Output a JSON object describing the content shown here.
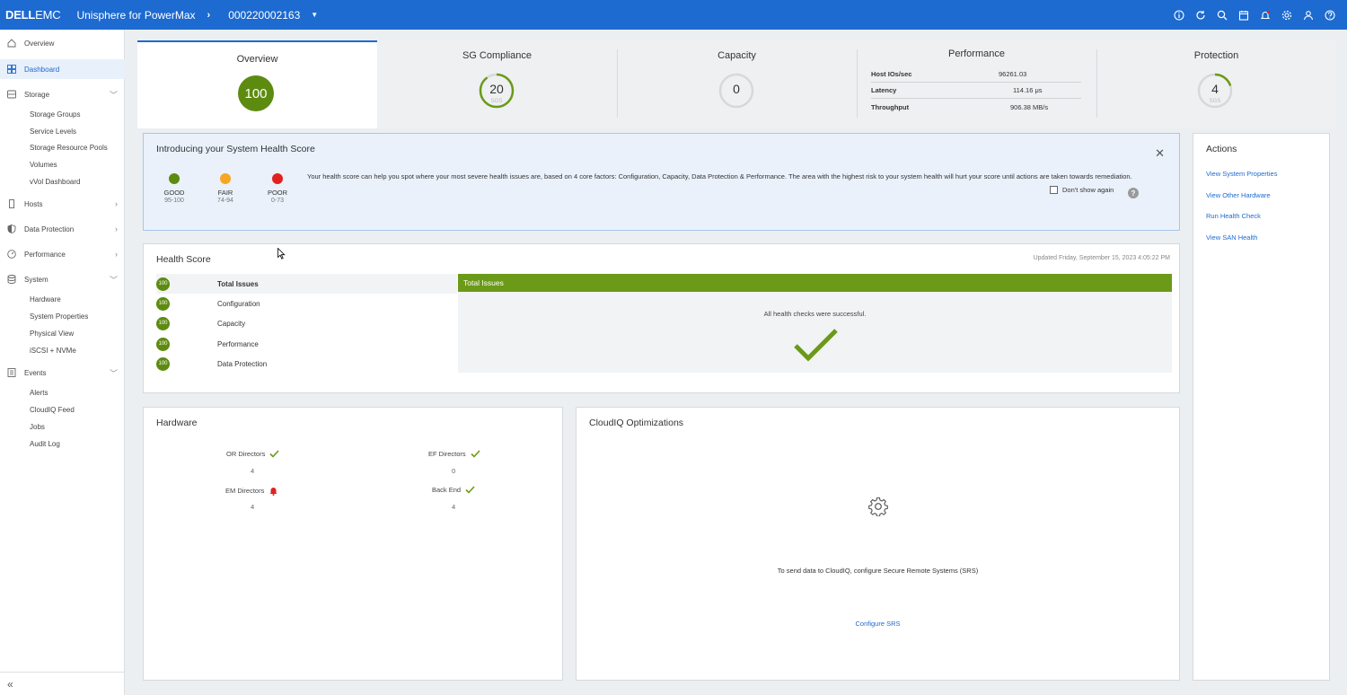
{
  "header": {
    "brand_bold": "DELL",
    "brand_light": "EMC",
    "app_title": "Unisphere for PowerMax",
    "system_id": "000220002163",
    "icons": [
      "info-icon",
      "refresh-icon",
      "search-icon",
      "calendar-icon",
      "bell-icon",
      "gear-icon",
      "user-icon",
      "help-icon"
    ]
  },
  "sidebar": {
    "items": [
      {
        "label": "Overview",
        "icon": "home-icon"
      },
      {
        "label": "Dashboard",
        "icon": "dashboard-icon"
      },
      {
        "label": "Storage",
        "icon": "storage-icon"
      },
      {
        "label": "Hosts",
        "icon": "host-icon"
      },
      {
        "label": "Data Protection",
        "icon": "shield-icon"
      },
      {
        "label": "Performance",
        "icon": "gauge-icon"
      },
      {
        "label": "System",
        "icon": "database-icon"
      },
      {
        "label": "Events",
        "icon": "list-icon"
      }
    ],
    "storage_sub": [
      "Storage Groups",
      "Service Levels",
      "Storage Resource Pools",
      "Volumes",
      "vVol Dashboard"
    ],
    "system_sub": [
      "Hardware",
      "System Properties",
      "Physical View",
      "iSCSI + NVMe"
    ],
    "events_sub": [
      "Alerts",
      "CloudIQ Feed",
      "Jobs",
      "Audit Log"
    ]
  },
  "tiles": {
    "overview": {
      "title": "Overview",
      "score": "100"
    },
    "sg": {
      "title": "SG Compliance",
      "value": "20",
      "unit": "SGS",
      "progress_fraction": 0.9
    },
    "capacity": {
      "title": "Capacity",
      "value": "0"
    },
    "performance": {
      "title": "Performance",
      "rows": [
        {
          "label": "Host IOs/sec",
          "value": "96261.03"
        },
        {
          "label": "Latency",
          "value": "114.16 μs"
        },
        {
          "label": "Throughput",
          "value": "906.38 MB/s"
        }
      ]
    },
    "protection": {
      "title": "Protection",
      "value": "4",
      "unit": "SGS",
      "progress_fraction": 0.2
    }
  },
  "intro": {
    "title": "Introducing your System Health Score",
    "legend": [
      {
        "label": "GOOD",
        "range": "95-100",
        "color": "#5d8b10"
      },
      {
        "label": "FAIR",
        "range": "74-94",
        "color": "#f6a623"
      },
      {
        "label": "POOR",
        "range": "0-73",
        "color": "#e0221f"
      }
    ],
    "text": "Your health score can help you spot where your most severe health issues are, based on 4 core factors: Configuration, Capacity, Data Protection & Performance. The area with the highest risk to your system health will hurt your score until actions are taken towards remediation.",
    "dont_show": "Don't show again",
    "help": "?"
  },
  "health": {
    "title": "Health Score",
    "updated": "Updated Friday, September 15, 2023 4:05:22 PM",
    "rows": [
      {
        "score": "100",
        "label": "Total Issues"
      },
      {
        "score": "100",
        "label": "Configuration"
      },
      {
        "score": "100",
        "label": "Capacity"
      },
      {
        "score": "100",
        "label": "Performance"
      },
      {
        "score": "100",
        "label": "Data Protection"
      }
    ],
    "detail_title": "Total Issues",
    "detail_message": "All health checks were successful."
  },
  "hardware": {
    "title": "Hardware",
    "items": [
      {
        "label": "OR Directors",
        "value": "4",
        "status": "ok"
      },
      {
        "label": "EF Directors",
        "value": "0",
        "status": "ok"
      },
      {
        "label": "EM Directors",
        "value": "4",
        "status": "alert"
      },
      {
        "label": "Back End",
        "value": "4",
        "status": "ok"
      }
    ]
  },
  "cloudiq": {
    "title": "CloudIQ Optimizations",
    "message": "To send data to CloudIQ, configure Secure Remote Systems (SRS)",
    "link": "Configure SRS"
  },
  "actions": {
    "title": "Actions",
    "links": [
      "View System Properties",
      "View Other Hardware",
      "Run Health Check",
      "View SAN Health"
    ]
  }
}
